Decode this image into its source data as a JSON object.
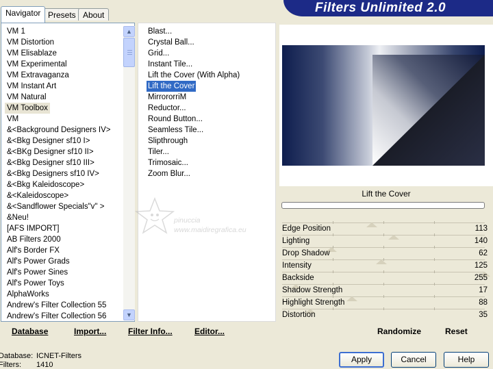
{
  "window": {
    "title": "Filters Unlimited 2.0"
  },
  "tabs": [
    "Navigator",
    "Presets",
    "About"
  ],
  "categories": [
    "VM 1",
    "VM Distortion",
    "VM Elisablaze",
    "VM Experimental",
    "VM Extravaganza",
    "VM Instant Art",
    "VM Natural",
    "VM Toolbox",
    "VM",
    "&<Background Designers IV>",
    "&<Bkg Designer sf10 I>",
    "&<BKg Designer sf10 II>",
    "&<Bkg Designer sf10 III>",
    "&<Bkg Designers sf10 IV>",
    "&<Bkg Kaleidoscope>",
    "&<Kaleidoscope>",
    "&<Sandflower Specials\"v\" >",
    "&Neu!",
    "[AFS IMPORT]",
    "AB Filters 2000",
    "Alf's Border FX",
    "Alf's Power Grads",
    "Alf's Power Sines",
    "Alf's Power Toys",
    "AlphaWorks",
    "Andrew's Filter Collection 55",
    "Andrew's Filter Collection 56"
  ],
  "selected_category": "VM Toolbox",
  "filters": [
    "Blast...",
    "Crystal Ball...",
    "Grid...",
    "Instant Tile...",
    "Lift the Cover (With Alpha)",
    "Lift the Cover",
    "MirrororriM",
    "Reductor...",
    "Round Button...",
    "Seamless Tile...",
    "Slipthrough",
    "Tiler...",
    "Trimosaic...",
    "Zoom Blur..."
  ],
  "selected_filter": "Lift the Cover",
  "preview": {
    "filter_name": "Lift the Cover"
  },
  "parameters": [
    {
      "label": "Edge Position",
      "value": 113
    },
    {
      "label": "Lighting",
      "value": 140
    },
    {
      "label": "Drop Shadow",
      "value": 62
    },
    {
      "label": "Intensity",
      "value": 125
    },
    {
      "label": "Backside",
      "value": 255
    },
    {
      "label": "Shadow Strength",
      "value": 17
    },
    {
      "label": "Highlight Strength",
      "value": 88
    },
    {
      "label": "Distortion",
      "value": 35
    }
  ],
  "slider_max": 255,
  "toolbar": {
    "database": "Database",
    "import": "Import...",
    "filter_info": "Filter Info...",
    "editor": "Editor...",
    "randomize": "Randomize",
    "reset": "Reset"
  },
  "status": {
    "database_label": "Database:",
    "database_value": "ICNET-Filters",
    "filters_label": "Filters:",
    "filters_value": "1410"
  },
  "buttons": {
    "apply": "Apply",
    "cancel": "Cancel",
    "help": "Help"
  },
  "watermark": {
    "name": "pinuccia",
    "url": "www.maidiregrafica.eu"
  }
}
